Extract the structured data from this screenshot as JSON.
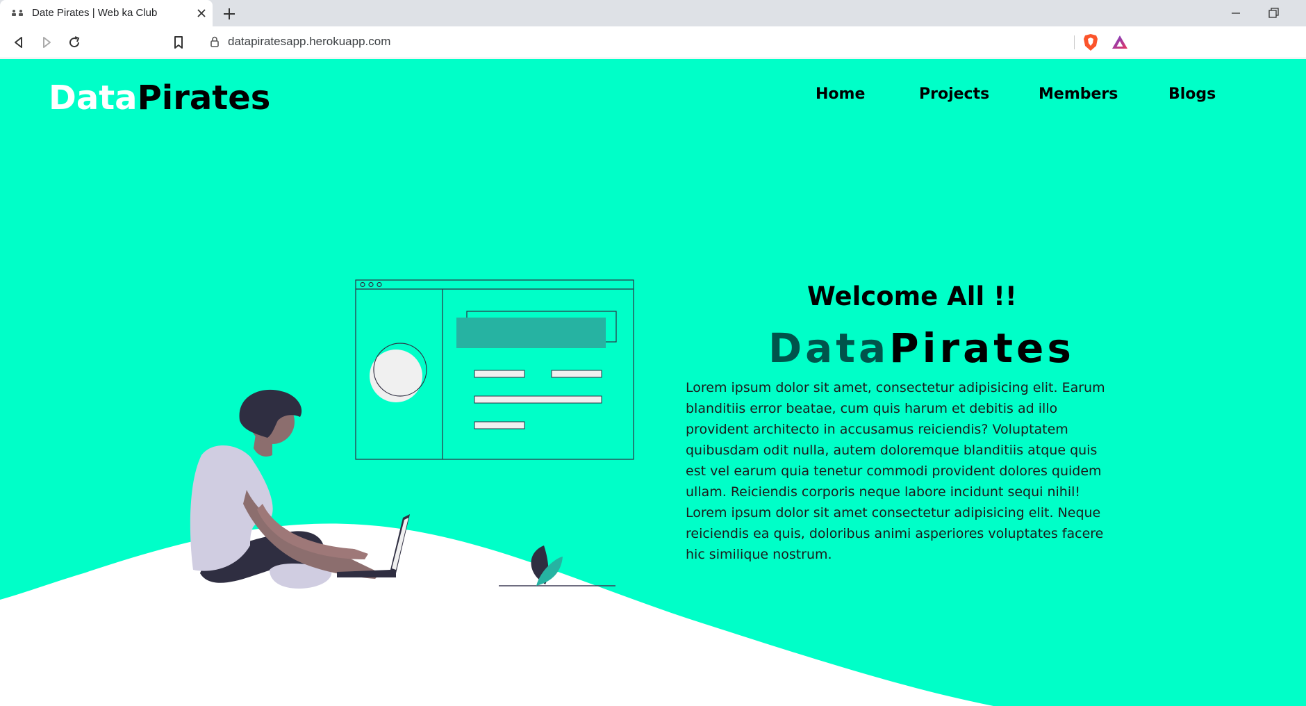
{
  "browser": {
    "tab_title": "Date Pirates | Web ka Club",
    "url": "datapiratesapp.herokuapp.com"
  },
  "site": {
    "logo_part1": "Data",
    "logo_part2": "Pirates",
    "nav": [
      "Home",
      "Projects",
      "Members",
      "Blogs"
    ]
  },
  "hero": {
    "welcome": "Welcome All !!",
    "brand_part1": "Data",
    "brand_part2": "Pirates",
    "description": "Lorem ipsum dolor sit amet, consectetur adipisicing elit. Earum blanditiis error beatae, cum quis harum et debitis ad illo provident architecto in accusamus reiciendis? Voluptatem quibusdam odit nulla, autem doloremque blanditiis atque quis est vel earum quia tenetur commodi provident dolores quidem ullam. Reiciendis corporis neque labore incidunt sequi nihil! Lorem ipsum dolor sit amet consectetur adipisicing elit. Neque reiciendis ea quis, doloribus animi asperiores voluptates facere hic similique nostrum."
  },
  "colors": {
    "primary": "#00ffc8",
    "accent_dark": "#00544b",
    "illustration_teal": "#26b3a2",
    "illustration_dark": "#2f2e41"
  },
  "icons": [
    "back-icon",
    "forward-icon",
    "reload-icon",
    "bookmark-icon",
    "lock-icon",
    "brave-shield-icon",
    "brave-rewards-icon",
    "minimize-icon",
    "restore-icon",
    "close-icon",
    "new-tab-icon"
  ]
}
